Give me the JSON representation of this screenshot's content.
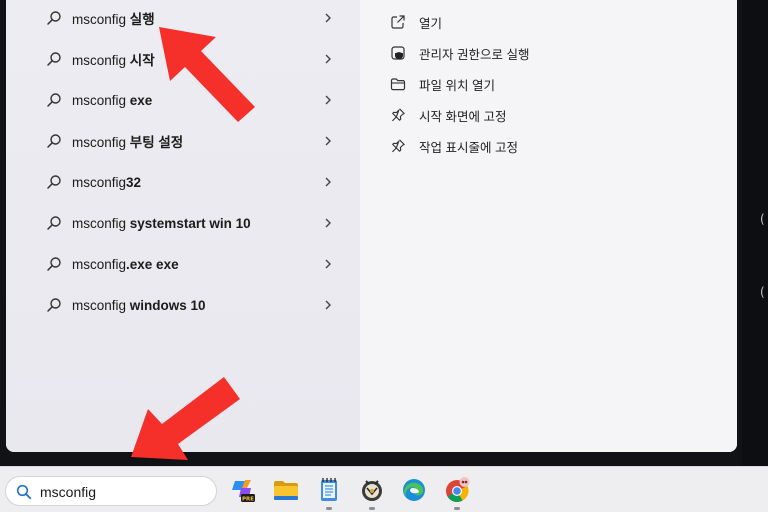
{
  "search": {
    "query": "msconfig",
    "placeholder": ""
  },
  "suggestions": [
    {
      "prefix": "msconfig ",
      "bold": "실행"
    },
    {
      "prefix": "msconfig ",
      "bold": "시작"
    },
    {
      "prefix": "msconfig ",
      "bold": "exe"
    },
    {
      "prefix": "msconfig ",
      "bold": "부팅 설정"
    },
    {
      "prefix": "msconfig",
      "bold": "32"
    },
    {
      "prefix": "msconfig ",
      "bold": "systemstart win 10"
    },
    {
      "prefix": "msconfig",
      "bold": ".exe exe"
    },
    {
      "prefix": "msconfig ",
      "bold": "windows 10"
    }
  ],
  "actions": [
    {
      "label": "열기",
      "icon": "open-external-icon"
    },
    {
      "label": "관리자 권한으로 실행",
      "icon": "shield-icon"
    },
    {
      "label": "파일 위치 열기",
      "icon": "folder-icon"
    },
    {
      "label": "시작 화면에 고정",
      "icon": "pin-icon"
    },
    {
      "label": "작업 표시줄에 고정",
      "icon": "pin-icon"
    }
  ],
  "taskbar_apps": [
    {
      "name": "copilot-pre",
      "icon": "copilot-pre-icon"
    },
    {
      "name": "file-explorer",
      "icon": "folder-icon"
    },
    {
      "name": "notepad",
      "icon": "notepad-icon"
    },
    {
      "name": "app-round",
      "icon": "app-icon"
    },
    {
      "name": "edge",
      "icon": "edge-icon"
    },
    {
      "name": "chrome",
      "icon": "chrome-icon"
    }
  ],
  "colors": {
    "annotation_arrow": "#f5302a",
    "panel_background": "#e9e8ef",
    "detail_background": "#f5f5f7",
    "taskbar_background": "#eeeef0"
  }
}
